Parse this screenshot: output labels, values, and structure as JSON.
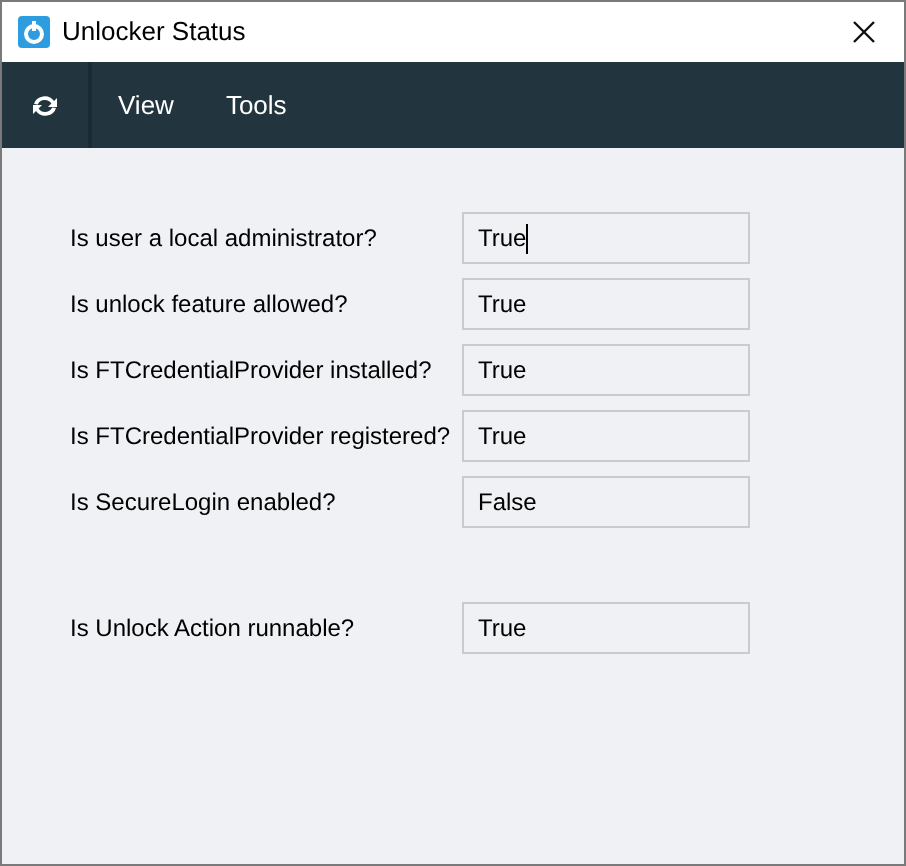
{
  "window": {
    "title": "Unlocker Status"
  },
  "toolbar": {
    "menus": [
      "View",
      "Tools"
    ]
  },
  "groups": [
    {
      "rows": [
        {
          "label": "Is user a local administrator?",
          "value": "True",
          "focused": true
        },
        {
          "label": "Is unlock feature allowed?",
          "value": "True",
          "focused": false
        },
        {
          "label": "Is FTCredentialProvider installed?",
          "value": "True",
          "focused": false
        },
        {
          "label": "Is FTCredentialProvider registered?",
          "value": "True",
          "focused": false
        },
        {
          "label": "Is SecureLogin enabled?",
          "value": "False",
          "focused": false
        }
      ]
    },
    {
      "rows": [
        {
          "label": "Is Unlock Action runnable?",
          "value": "True",
          "focused": false
        }
      ]
    }
  ]
}
